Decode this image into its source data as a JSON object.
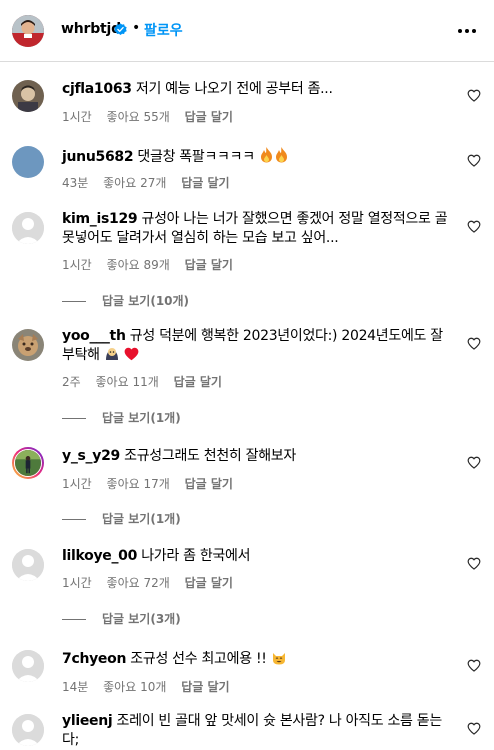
{
  "header": {
    "username": "whrbtjd",
    "dot": "•",
    "follow_label": "팔로우",
    "more_icon": "more-horizontal-icon"
  },
  "comments": [
    {
      "username": "cjfla1063",
      "text": "저기 예능 나오기 전에 공부터 좀...",
      "time": "1시간",
      "likes": "좋아요 55개",
      "reply": "답글 달기"
    },
    {
      "username": "junu5682",
      "text": "댓글창 폭팔ㅋㅋㅋㅋ",
      "time": "43분",
      "likes": "좋아요 27개",
      "reply": "답글 달기"
    },
    {
      "username": "kim_is129",
      "text": "규성아 나는 너가 잘했으면 좋겠어 정말 열정적으로 골 못넣어도 달려가서 열심히 하는 모습 보고 싶어...",
      "time": "1시간",
      "likes": "좋아요 89개",
      "reply": "답글 달기",
      "thread": "답글 보기(10개)"
    },
    {
      "username": "yoo___th",
      "text": "규성 덕분에 행복한 2023년이었다:) 2024년도에도 잘 부탁해",
      "time": "2주",
      "likes": "좋아요 11개",
      "reply": "답글 달기",
      "thread": "답글 보기(1개)"
    },
    {
      "username": "y_s_y29",
      "text": "조규성그래도 천천히 잘해보자",
      "time": "1시간",
      "likes": "좋아요 17개",
      "reply": "답글 달기",
      "thread": "답글 보기(1개)"
    },
    {
      "username": "lilkoye_00",
      "text": "나가라 좀 한국에서",
      "time": "1시간",
      "likes": "좋아요 72개",
      "reply": "답글 달기",
      "thread": "답글 보기(3개)"
    },
    {
      "username": "7chyeon",
      "text": "조규성 선수 최고에용 !!",
      "time": "14분",
      "likes": "좋아요 10개",
      "reply": "답글 달기"
    },
    {
      "username": "ylieenj",
      "text": "조레이 빈 골대 앞 맛세이 슛 본사람? 나 아직도 소름 돋는다;"
    }
  ],
  "colors": {
    "accent": "#0095f6",
    "meta": "#737373",
    "divider": "#dbdbdb",
    "heart": "#ed4956"
  }
}
